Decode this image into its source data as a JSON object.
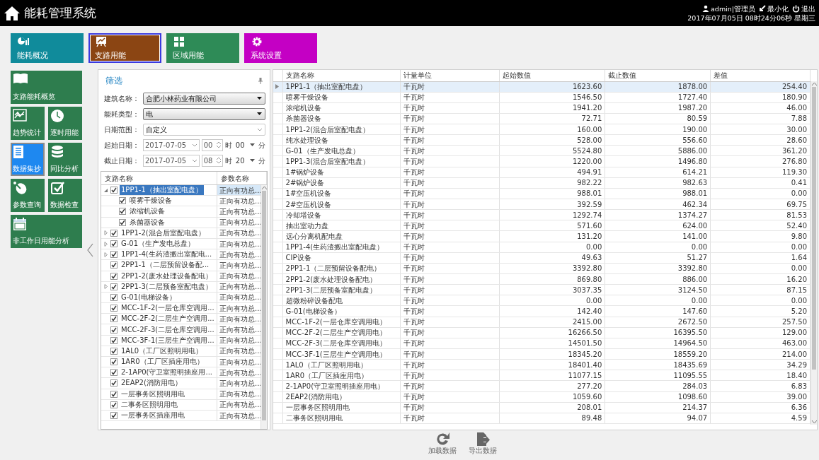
{
  "header": {
    "title": "能耗管理系统",
    "user": "admin|管理员",
    "minimize": "最小化",
    "logout": "退出",
    "datetime": "2017年07月05日 08时24分06秒 星期三"
  },
  "modules": [
    {
      "label": "能耗概况",
      "color": "#108b9b",
      "selected": false
    },
    {
      "label": "支路用能",
      "color": "#8b4513",
      "selected": true
    },
    {
      "label": "区域用能",
      "color": "#2e8b57",
      "selected": false
    },
    {
      "label": "系统设置",
      "color": "#c400c4",
      "selected": false
    }
  ],
  "sidebar": [
    {
      "label": "支路能耗概览",
      "kind": "wide",
      "selected": false
    },
    {
      "label": "趋势统计",
      "kind": "half",
      "selected": false
    },
    {
      "label": "逐时用能",
      "kind": "half",
      "selected": false
    },
    {
      "label": "数据集抄",
      "kind": "half",
      "selected": true
    },
    {
      "label": "同比分析",
      "kind": "half",
      "selected": false
    },
    {
      "label": "参数查询",
      "kind": "half",
      "selected": false
    },
    {
      "label": "数据检查",
      "kind": "half",
      "selected": false
    },
    {
      "label": "非工作日用能分析",
      "kind": "wide",
      "selected": false
    }
  ],
  "filter": {
    "title": "筛选",
    "fields": [
      {
        "label": "建筑名称：",
        "value": "合肥小林药业有限公司",
        "kind": "select"
      },
      {
        "label": "能耗类型：",
        "value": "电",
        "kind": "select"
      },
      {
        "label": "日期范围：",
        "value": "自定义",
        "kind": "combo"
      }
    ],
    "dates": [
      {
        "label": "起始日期：",
        "date": "2017-07-05",
        "hour": "00",
        "hour_unit": "时",
        "minute": "00",
        "minute_unit": "分"
      },
      {
        "label": "截止日期：",
        "date": "2017-07-05",
        "hour": "08",
        "hour_unit": "时",
        "minute": "20",
        "minute_unit": "分"
      }
    ],
    "tree": {
      "columns": [
        "支路名称",
        "参数名称"
      ],
      "items": [
        {
          "name": "1PP1-1（抽出室配电盘）",
          "param": "正向有功总...",
          "checked": true,
          "selected": true,
          "expanded": true,
          "children": [
            {
              "name": "喷雾干燥设备",
              "param": "正向有功总...",
              "checked": true,
              "selected": false
            },
            {
              "name": "浓缩机设备",
              "param": "正向有功总...",
              "checked": true,
              "selected": false
            },
            {
              "name": "杀菌器设备",
              "param": "正向有功总...",
              "checked": true,
              "selected": false
            }
          ]
        },
        {
          "name": "1PP1-2(混合后室配电盘）",
          "param": "正向有功总...",
          "checked": true,
          "selected": false,
          "expanded": false
        },
        {
          "name": "G-01（生产发电总盘）",
          "param": "正向有功总...",
          "checked": true,
          "selected": false,
          "expanded": false
        },
        {
          "name": "1PP1-4(生药渣搬出室配电...",
          "param": "正向有功总...",
          "checked": true,
          "selected": false,
          "expanded": false
        },
        {
          "name": "2PP1-1（二层预留设备配...",
          "param": "正向有功总...",
          "checked": true,
          "selected": false
        },
        {
          "name": "2PP1-2(废水处理设备配电）",
          "param": "正向有功总...",
          "checked": true,
          "selected": false
        },
        {
          "name": "2PP1-3(二层预备室配电盘）",
          "param": "正向有功总...",
          "checked": true,
          "selected": false,
          "expanded": false
        },
        {
          "name": "G-01(电梯设备）",
          "param": "正向有功总...",
          "checked": true,
          "selected": false
        },
        {
          "name": "MCC-1F-2(一层仓库空调用...",
          "param": "正向有功总...",
          "checked": true,
          "selected": false
        },
        {
          "name": "MCC-2F-2(二层生产空调用...",
          "param": "正向有功总...",
          "checked": true,
          "selected": false
        },
        {
          "name": "MCC-2F-3(二层仓库空调用...",
          "param": "正向有功总...",
          "checked": true,
          "selected": false
        },
        {
          "name": "MCC-3F-1(三层生产空调用...",
          "param": "正向有功总...",
          "checked": true,
          "selected": false
        },
        {
          "name": "1AL0（工厂区照明用电）",
          "param": "正向有功总...",
          "checked": true,
          "selected": false
        },
        {
          "name": "1AR0（工厂区插座用电）",
          "param": "正向有功总...",
          "checked": true,
          "selected": false
        },
        {
          "name": "2-1AP0(守卫室照明插座用...",
          "param": "正向有功总...",
          "checked": true,
          "selected": false
        },
        {
          "name": "2EAP2(消防用电）",
          "param": "正向有功总...",
          "checked": true,
          "selected": false
        },
        {
          "name": "一层事务区照明用电",
          "param": "正向有功总...",
          "checked": true,
          "selected": false
        },
        {
          "name": "二事务区照明用电",
          "param": "正向有功总...",
          "checked": true,
          "selected": false
        },
        {
          "name": "一层事务区插座用电",
          "param": "正向有功总...",
          "checked": true,
          "selected": false
        }
      ]
    }
  },
  "table": {
    "columns": [
      "支路名称",
      "计量单位",
      "起始数值",
      "截止数值",
      "差值"
    ],
    "rows": [
      {
        "cells": [
          "1PP1-1（抽出室配电盘）",
          "千瓦时",
          "1623.60",
          "1878.00",
          "254.40"
        ],
        "selected": true
      },
      {
        "cells": [
          "喷雾干燥设备",
          "千瓦时",
          "1546.50",
          "1727.40",
          "180.90"
        ],
        "selected": false
      },
      {
        "cells": [
          "浓缩机设备",
          "千瓦时",
          "1941.20",
          "1987.20",
          "46.00"
        ],
        "selected": false
      },
      {
        "cells": [
          "杀菌器设备",
          "千瓦时",
          "72.71",
          "80.59",
          "7.88"
        ],
        "selected": false
      },
      {
        "cells": [
          "1PP1-2(混合后室配电盘）",
          "千瓦时",
          "160.00",
          "190.00",
          "30.00"
        ],
        "selected": false
      },
      {
        "cells": [
          "纯水处理设备",
          "千瓦时",
          "528.00",
          "556.60",
          "28.60"
        ],
        "selected": false
      },
      {
        "cells": [
          "G-01（生产发电总盘）",
          "千瓦时",
          "5524.80",
          "5886.00",
          "361.20"
        ],
        "selected": false
      },
      {
        "cells": [
          "1PP1-3(混合后室配电盘）",
          "千瓦时",
          "1220.00",
          "1496.80",
          "276.80"
        ],
        "selected": false
      },
      {
        "cells": [
          "1#锅炉设备",
          "千瓦时",
          "494.91",
          "614.21",
          "119.30"
        ],
        "selected": false
      },
      {
        "cells": [
          "2#锅炉设备",
          "千瓦时",
          "982.22",
          "982.63",
          "0.41"
        ],
        "selected": false
      },
      {
        "cells": [
          "1#空压机设备",
          "千瓦时",
          "988.01",
          "988.01",
          "0.00"
        ],
        "selected": false
      },
      {
        "cells": [
          "2#空压机设备",
          "千瓦时",
          "392.59",
          "462.34",
          "69.75"
        ],
        "selected": false
      },
      {
        "cells": [
          "冷却塔设备",
          "千瓦时",
          "1292.74",
          "1374.27",
          "81.53"
        ],
        "selected": false
      },
      {
        "cells": [
          "抽出室动力盘",
          "千瓦时",
          "571.60",
          "624.00",
          "52.40"
        ],
        "selected": false
      },
      {
        "cells": [
          "远心分离机配电盘",
          "千瓦时",
          "131.20",
          "141.00",
          "9.80"
        ],
        "selected": false
      },
      {
        "cells": [
          "1PP1-4(生药渣搬出室配电盘）",
          "千瓦时",
          "0.00",
          "0.00",
          "0.00"
        ],
        "selected": false
      },
      {
        "cells": [
          "CIP设备",
          "千瓦时",
          "49.63",
          "51.27",
          "1.64"
        ],
        "selected": false
      },
      {
        "cells": [
          "2PP1-1（二层预留设备配电）",
          "千瓦时",
          "3392.80",
          "3392.80",
          "0.00"
        ],
        "selected": false
      },
      {
        "cells": [
          "2PP1-2(废水处理设备配电）",
          "千瓦时",
          "869.80",
          "886.00",
          "16.20"
        ],
        "selected": false
      },
      {
        "cells": [
          "2PP1-3(二层预备室配电盘）",
          "千瓦时",
          "3037.35",
          "3124.50",
          "87.15"
        ],
        "selected": false
      },
      {
        "cells": [
          "超微粉碎设备配电",
          "千瓦时",
          "0.00",
          "0.00",
          "0.00"
        ],
        "selected": false
      },
      {
        "cells": [
          "G-01(电梯设备）",
          "千瓦时",
          "142.40",
          "147.60",
          "5.20"
        ],
        "selected": false
      },
      {
        "cells": [
          "MCC-1F-2(一层仓库空调用电）",
          "千瓦时",
          "2415.00",
          "2672.50",
          "257.50"
        ],
        "selected": false
      },
      {
        "cells": [
          "MCC-2F-2(二层生产空调用电）",
          "千瓦时",
          "16266.50",
          "16395.50",
          "129.00"
        ],
        "selected": false
      },
      {
        "cells": [
          "MCC-2F-3(二层仓库空调用电）",
          "千瓦时",
          "14501.50",
          "14964.50",
          "463.00"
        ],
        "selected": false
      },
      {
        "cells": [
          "MCC-3F-1(三层生产空调用电）",
          "千瓦时",
          "18345.20",
          "18559.20",
          "214.00"
        ],
        "selected": false
      },
      {
        "cells": [
          "1AL0（工厂区照明用电）",
          "千瓦时",
          "18401.40",
          "18435.69",
          "34.29"
        ],
        "selected": false
      },
      {
        "cells": [
          "1AR0（工厂区插座用电）",
          "千瓦时",
          "11077.15",
          "11095.55",
          "18.40"
        ],
        "selected": false
      },
      {
        "cells": [
          "2-1AP0(守卫室照明插座用电）",
          "千瓦时",
          "277.20",
          "284.03",
          "6.83"
        ],
        "selected": false
      },
      {
        "cells": [
          "2EAP2(消防用电）",
          "千瓦时",
          "1059.60",
          "1098.60",
          "39.00"
        ],
        "selected": false
      },
      {
        "cells": [
          "一层事务区照明用电",
          "千瓦时",
          "208.01",
          "214.37",
          "6.36"
        ],
        "selected": false
      },
      {
        "cells": [
          "二事务区照明用电",
          "千瓦时",
          "89.48",
          "94.07",
          "4.59"
        ],
        "selected": false
      }
    ]
  },
  "actions": [
    {
      "label": "加载数据"
    },
    {
      "label": "导出数据"
    }
  ]
}
